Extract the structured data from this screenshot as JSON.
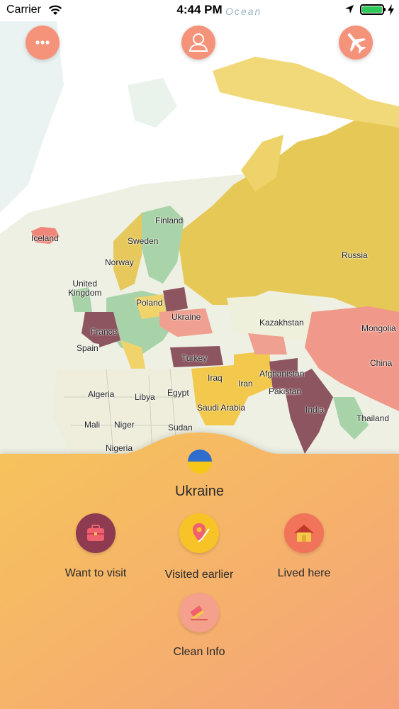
{
  "status_bar": {
    "carrier": "Carrier",
    "time": "4:44 PM",
    "ocean_label": "Ocean",
    "battery_level": 1.0
  },
  "top_buttons": {
    "menu": "menu-dots-icon",
    "profile": "user-icon",
    "travel": "airplane-icon"
  },
  "map": {
    "labels": {
      "iceland": "Iceland",
      "finland": "Finland",
      "sweden": "Sweden",
      "norway": "Norway",
      "united_kingdom": "United\nKingdom",
      "poland": "Poland",
      "ukraine": "Ukraine",
      "france": "France",
      "spain": "Spain",
      "turkey": "Turkey",
      "russia": "Russia",
      "kazakhstan": "Kazakhstan",
      "mongolia": "Mongolia",
      "china": "China",
      "afghanistan": "Afghanistan",
      "pakistan": "Pakistan",
      "india": "India",
      "thailand": "Thailand",
      "iraq": "Iraq",
      "iran": "Iran",
      "saudi_arabia": "Saudi Arabia",
      "egypt": "Egypt",
      "libya": "Libya",
      "algeria": "Algeria",
      "mali": "Mali",
      "niger": "Niger",
      "sudan": "Sudan",
      "nigeria": "Nigeria"
    },
    "colors": {
      "want_to_visit": "#9b5a66",
      "visited": "#f2c94c",
      "lived": "#f4876f",
      "selected": "#f0a090"
    }
  },
  "sheet": {
    "country": "Ukraine",
    "actions": {
      "want_to_visit": "Want to visit",
      "visited_earlier": "Visited earlier",
      "lived_here": "Lived here",
      "clean_info": "Clean Info"
    },
    "colors": {
      "gradient_start": "#f6c45a",
      "gradient_end": "#f5a27a",
      "want_to_visit_circle": "#8e3b52",
      "visited_circle": "#f8c327",
      "lived_circle": "#f0735a",
      "clean_circle": "#f4a08c"
    }
  }
}
